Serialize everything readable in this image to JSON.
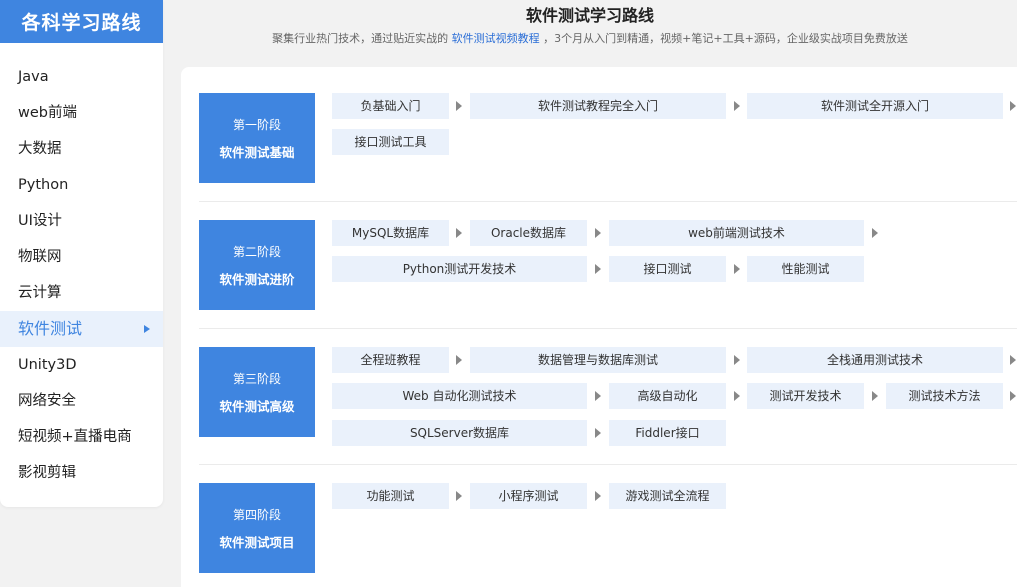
{
  "sidebar": {
    "title": "各科学习路线",
    "items": [
      {
        "label": "Java"
      },
      {
        "label": "web前端"
      },
      {
        "label": "大数据"
      },
      {
        "label": "Python"
      },
      {
        "label": "UI设计"
      },
      {
        "label": "物联网"
      },
      {
        "label": "云计算"
      },
      {
        "label": "软件测试",
        "active": true
      },
      {
        "label": "Unity3D"
      },
      {
        "label": "网络安全"
      },
      {
        "label": "短视频+直播电商"
      },
      {
        "label": "影视剪辑"
      }
    ]
  },
  "header": {
    "title": "软件测试学习路线",
    "subtitle_before": "聚集行业热门技术，通过贴近实战的 ",
    "subtitle_link": "软件测试视频教程",
    "subtitle_after": " ，3个月从入门到精通，视频+笔记+工具+源码，企业级实战项目免费放送"
  },
  "stages": [
    {
      "num": "第一阶段",
      "name": "软件测试基础",
      "courses": [
        "负基础入门",
        "软件测试教程完全入门",
        "软件测试全开源入门",
        "接口测试工具"
      ]
    },
    {
      "num": "第二阶段",
      "name": "软件测试进阶",
      "courses": [
        "MySQL数据库",
        "Oracle数据库",
        "web前端测试技术",
        "Python测试开发技术",
        "接口测试",
        "性能测试"
      ]
    },
    {
      "num": "第三阶段",
      "name": "软件测试高级",
      "courses": [
        "全程班教程",
        "数据管理与数据库测试",
        "全栈通用测试技术",
        "Web 自动化测试技术",
        "高级自动化",
        "测试开发技术",
        "测试技术方法",
        "SQLServer数据库",
        "Fiddler接口"
      ]
    },
    {
      "num": "第四阶段",
      "name": "软件测试项目",
      "courses": [
        "功能测试",
        "小程序测试",
        "游戏测试全流程"
      ]
    }
  ]
}
